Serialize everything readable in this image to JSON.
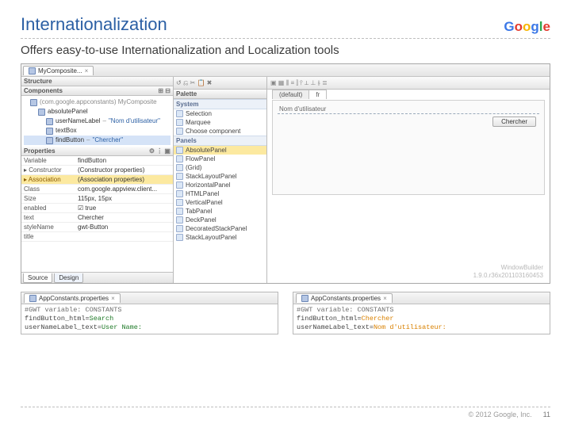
{
  "header": {
    "title": "Internationalization",
    "logo": "Google"
  },
  "subtitle": "Offers easy-to-use Internationalization and Localization tools",
  "ide": {
    "file_tab": "MyComposite...",
    "left": {
      "structure_title": "Structure",
      "components_title": "Components",
      "root": "(com.google.appconstants) MyComposite",
      "nodes": [
        {
          "name": "absolutePanel",
          "val": ""
        },
        {
          "name": "userNameLabel",
          "val": "\"Nom d'utilisateur\""
        },
        {
          "name": "textBox",
          "val": ""
        },
        {
          "name": "findButton",
          "val": "\"Chercher\""
        }
      ],
      "properties_title": "Properties",
      "props": [
        {
          "k": "Variable",
          "v": "findButton"
        },
        {
          "k": "Constructor",
          "v": "(Constructor properties)"
        },
        {
          "k": "Association",
          "v": "(Association properties)",
          "sel": true
        },
        {
          "k": "Class",
          "v": "com.google.appview.client..."
        },
        {
          "k": "Size",
          "v": "115px, 15px"
        },
        {
          "k": "enabled",
          "v": "true",
          "checkbox": true
        },
        {
          "k": "text",
          "v": "Chercher"
        },
        {
          "k": "styleName",
          "v": "gwt-Button"
        },
        {
          "k": "title",
          "v": ""
        }
      ],
      "bottom_tabs": {
        "source": "Source",
        "design": "Design"
      }
    },
    "palette": {
      "title": "Palette",
      "cats": {
        "system": "System",
        "panels": "Panels"
      },
      "system_items": [
        "Selection",
        "Marquee",
        "Choose component"
      ],
      "panel_items": [
        "AbsolutePanel",
        "FlowPanel",
        "(Grid)",
        "StackLayoutPanel",
        "HorizontalPanel",
        "HTMLPanel",
        "VerticalPanel",
        "",
        "TabPanel",
        "DeckPanel",
        "DecoratedStackPanel",
        "StackLayoutPanel"
      ]
    },
    "canvas": {
      "locales": {
        "default": "(default)",
        "fr": "fr"
      },
      "label": "Nom d'utilisateur",
      "button": "Chercher",
      "watermark1": "WindowBuilder",
      "watermark2": "1.9.0.r36x201103160453"
    }
  },
  "code": {
    "tab_label": "AppConstants.properties",
    "left": {
      "line1_k": "#GWT variable:",
      "line1_v": "CONSTANTS",
      "line2_k": "findButton_html",
      "line2_v": "Search",
      "line3_k": "userNameLabel_text",
      "line3_v": "User Name:"
    },
    "right": {
      "line1_k": "#GWT variable:",
      "line1_v": "CONSTANTS",
      "line2_k": "findButton_html",
      "line2_v": "Chercher",
      "line3_k": "userNameLabel_text",
      "line3_v": "Nom d'utilisateur:"
    }
  },
  "footer": {
    "copyright": "© 2012 Google, Inc.",
    "page": "11"
  }
}
